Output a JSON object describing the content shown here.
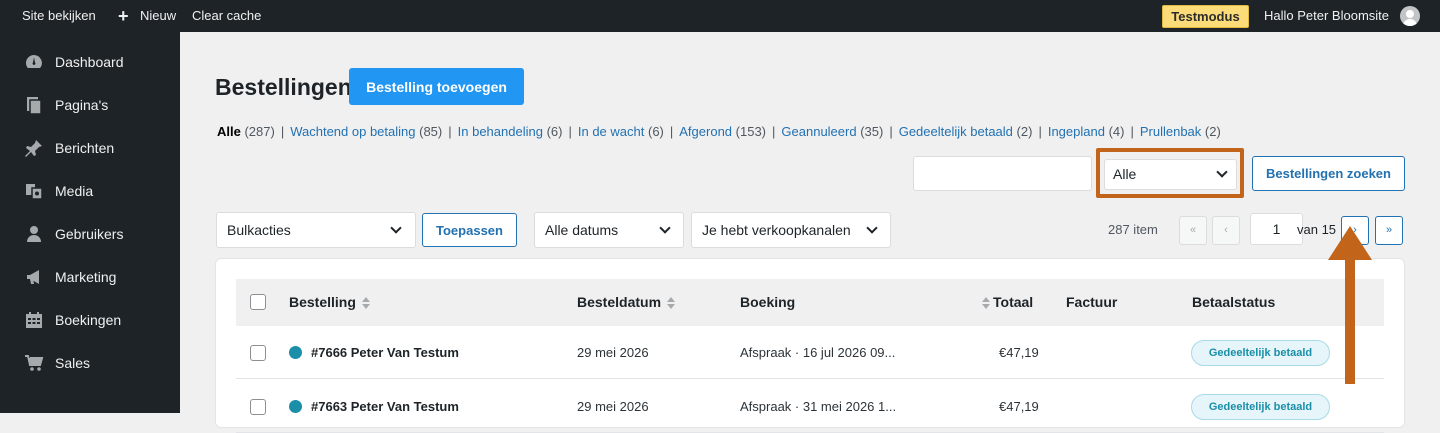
{
  "adminbar": {
    "site_link": "Site bekijken",
    "new_label": "Nieuw",
    "clear_cache": "Clear cache",
    "test_mode": "Testmodus",
    "greeting": "Hallo Peter Bloomsite"
  },
  "sidebar": {
    "items": [
      {
        "label": "Dashboard",
        "icon": "dashboard-icon"
      },
      {
        "label": "Pagina's",
        "icon": "pages-icon"
      },
      {
        "label": "Berichten",
        "icon": "pin-icon"
      },
      {
        "label": "Media",
        "icon": "media-icon"
      },
      {
        "label": "Gebruikers",
        "icon": "user-icon"
      },
      {
        "label": "Marketing",
        "icon": "megaphone-icon"
      },
      {
        "label": "Boekingen",
        "icon": "calendar-icon"
      },
      {
        "label": "Sales",
        "icon": "cart-icon"
      }
    ]
  },
  "page": {
    "title": "Bestellingen",
    "add_button": "Bestelling toevoegen"
  },
  "filters": [
    {
      "label": "Alle",
      "count": "(287)",
      "current": true
    },
    {
      "label": "Wachtend op betaling",
      "count": "(85)"
    },
    {
      "label": "In behandeling",
      "count": "(6)"
    },
    {
      "label": "In de wacht",
      "count": "(6)"
    },
    {
      "label": "Afgerond",
      "count": "(153)"
    },
    {
      "label": "Geannuleerd",
      "count": "(35)"
    },
    {
      "label": "Gedeeltelijk betaald",
      "count": "(2)"
    },
    {
      "label": "Ingepland",
      "count": "(4)"
    },
    {
      "label": "Prullenbak",
      "count": "(2)"
    }
  ],
  "search": {
    "input_value": "",
    "status_selected": "Alle",
    "button": "Bestellingen zoeken"
  },
  "toolbar": {
    "bulk_actions": "Bulkacties",
    "apply": "Toepassen",
    "dates": "Alle datums",
    "channels": "Je hebt verkoopkanalen",
    "items_count": "287 item",
    "first_page": "«",
    "prev_page": "‹",
    "current_page": "1",
    "of_pages": "van 15",
    "next_page": "›",
    "last_page": "»"
  },
  "table": {
    "headers": {
      "order": "Bestelling",
      "date": "Besteldatum",
      "booking": "Boeking",
      "total": "Totaal",
      "invoice": "Factuur",
      "payment_status": "Betaalstatus"
    },
    "rows": [
      {
        "order": "#7666 Peter Van Testum",
        "date": "29 mei 2026",
        "booking": "Afspraak · 16 jul 2026 09...",
        "total": "€47,19",
        "invoice": "",
        "status": "Gedeeltelijk betaald"
      },
      {
        "order": "#7663 Peter Van Testum",
        "date": "29 mei 2026",
        "booking": "Afspraak · 31 mei 2026 1...",
        "total": "€47,19",
        "invoice": "",
        "status": "Gedeeltelijk betaald"
      }
    ]
  },
  "colors": {
    "admin_dark": "#1d2327",
    "primary_blue": "#2196f3",
    "link_blue": "#2271b1",
    "highlight_orange": "#c2651a",
    "status_teal": "#1b8fa8",
    "test_mode_yellow": "#fcdc78"
  }
}
